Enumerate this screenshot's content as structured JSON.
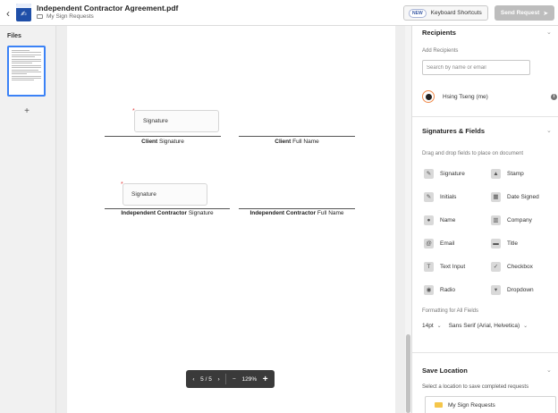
{
  "header": {
    "back_icon": "chevron-left-icon",
    "document_title": "Independent Contractor Agreement.pdf",
    "folder_name": "My Sign Requests",
    "new_badge": "NEW",
    "shortcuts_label": "Keyboard Shortcuts",
    "send_label": "Send Request",
    "send_icon": "paper-plane-icon"
  },
  "files": {
    "label": "Files",
    "add_icon": "plus-icon"
  },
  "document": {
    "signature_fields": [
      {
        "label": "Signature",
        "required_mark": "*"
      },
      {
        "label": "Signature",
        "required_mark": "*"
      }
    ],
    "lines": [
      {
        "bold": "Client",
        "rest": " Signature"
      },
      {
        "bold": "Client",
        "rest": " Full Name"
      },
      {
        "bold": "Independent Contractor",
        "rest": " Signature"
      },
      {
        "bold": "Independent Contractor",
        "rest": " Full Name"
      }
    ]
  },
  "toolbar": {
    "prev": "‹",
    "page_indicator": "5 / 5",
    "next": "›",
    "zoom_out": "−",
    "zoom_level": "129%",
    "zoom_in": "+"
  },
  "right_panel": {
    "recipients": {
      "title": "Recipients",
      "add_label": "Add Recipients",
      "search_placeholder": "Search by name or email",
      "recipient_name": "Hsing Tseng (me)"
    },
    "fields": {
      "title": "Signatures & Fields",
      "instructions": "Drag and drop fields to place on document",
      "items": [
        {
          "label": "Signature",
          "icon": "signature-icon"
        },
        {
          "label": "Stamp",
          "icon": "stamp-icon"
        },
        {
          "label": "Initials",
          "icon": "initials-icon"
        },
        {
          "label": "Date Signed",
          "icon": "calendar-icon"
        },
        {
          "label": "Name",
          "icon": "person-icon"
        },
        {
          "label": "Company",
          "icon": "building-icon"
        },
        {
          "label": "Email",
          "icon": "at-icon"
        },
        {
          "label": "Title",
          "icon": "id-card-icon"
        },
        {
          "label": "Text Input",
          "icon": "text-icon"
        },
        {
          "label": "Checkbox",
          "icon": "checkbox-icon"
        },
        {
          "label": "Radio",
          "icon": "radio-icon"
        },
        {
          "label": "Dropdown",
          "icon": "dropdown-icon"
        }
      ],
      "formatting_label": "Formatting for All Fields",
      "font_size": "14pt",
      "font_family": "Sans Serif (Arial, Helvetica)"
    },
    "save": {
      "title": "Save Location",
      "instructions": "Select a location to save completed requests",
      "folder": "My Sign Requests"
    }
  },
  "colors": {
    "accent": "#3b82f6",
    "brand": "#1f4fa8",
    "required": "#e03b3b",
    "avatar_ring": "#f08a4b"
  }
}
